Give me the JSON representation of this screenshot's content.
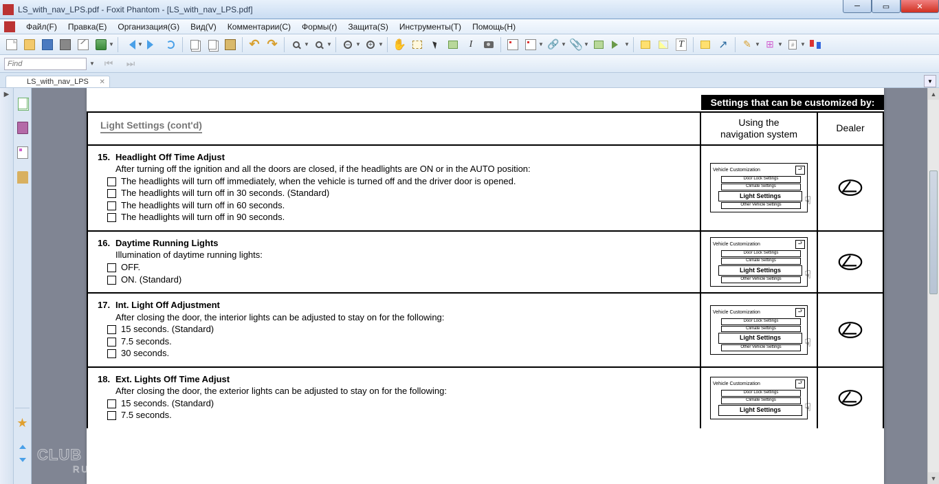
{
  "window": {
    "title": "LS_with_nav_LPS.pdf - Foxit Phantom - [LS_with_nav_LPS.pdf]"
  },
  "menu": [
    "Файл(F)",
    "Правка(E)",
    "Организация(G)",
    "Вид(V)",
    "Комментарии(C)",
    "Формы(r)",
    "Защита(S)",
    "Инструменты(T)",
    "Помощь(H)"
  ],
  "find": {
    "placeholder": "Find"
  },
  "tab": {
    "label": "LS_with_nav_LPS"
  },
  "doc": {
    "header_banner": "Settings that can be customized by:",
    "col_nav_l1": "Using the",
    "col_nav_l2": "navigation system",
    "col_dealer": "Dealer",
    "section_title": "Light Settings (cont'd)",
    "nav_diag": {
      "title": "Vehicle Customization",
      "back": "⮐",
      "rows": [
        "Door Lock Settings",
        "Climate Settings"
      ],
      "selected": "Light Settings",
      "after": "Other Vehicle Settings"
    },
    "items": [
      {
        "no": "15.",
        "title": "Headlight Off Time Adjust",
        "intro": "After turning off the ignition and all the doors are closed, if the headlights are ON or in the AUTO position:",
        "opts": [
          "The headlights will turn off immediately, when the vehicle is turned off and the driver door is opened.",
          "The headlights will turn off in 30 seconds. (Standard)",
          "The headlights will turn off in 60 seconds.",
          "The headlights will turn off in 90 seconds."
        ]
      },
      {
        "no": "16.",
        "title": "Daytime Running Lights",
        "intro": "Illumination of daytime running lights:",
        "opts": [
          "OFF.",
          "ON. (Standard)"
        ]
      },
      {
        "no": "17.",
        "title": "Int. Light Off Adjustment",
        "intro": "After closing the door, the interior lights can be adjusted to stay on for the following:",
        "opts": [
          "15 seconds. (Standard)",
          "7.5 seconds.",
          "30 seconds."
        ]
      },
      {
        "no": "18.",
        "title": "Ext. Lights Off Time Adjust",
        "intro": "After closing the door, the exterior lights can be adjusted to stay on for the following:",
        "opts": [
          "15 seconds. (Standard)",
          "7.5 seconds."
        ]
      }
    ]
  },
  "watermark": {
    "line1": "CLUB LEXUS",
    "line2": "RUSSIA"
  }
}
